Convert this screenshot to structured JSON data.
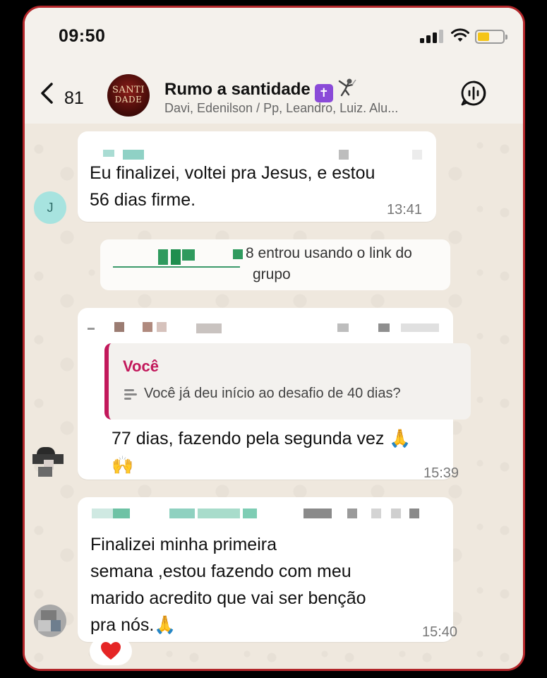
{
  "status_bar": {
    "time": "09:50",
    "battery_color": "#f5c518"
  },
  "header": {
    "back_count": "81",
    "group_name": "Rumo a santidade",
    "group_avatar_line1": "SANTI",
    "group_avatar_line2": "DADE",
    "members": "Davi, Edenilson / Pp, Leandro, Luiz. Alu...",
    "icons": [
      "chevron-left-icon",
      "cross-emoji-icon",
      "fencer-emoji-icon",
      "voice-chat-icon"
    ]
  },
  "messages": [
    {
      "type": "incoming",
      "avatar_initial": "J",
      "text_lines": [
        "Eu finalizei, voltei pra Jesus, e estou",
        "56 dias firme."
      ],
      "time": "13:41"
    },
    {
      "type": "system",
      "text_partial": "8 entrou usando o link do",
      "text_line2": "grupo"
    },
    {
      "type": "incoming",
      "quote": {
        "author": "Você",
        "text": "Você já deu início ao desafio de 40 dias?"
      },
      "text_line1": "77 dias, fazendo pela segunda vez 🙏",
      "text_line2": "🙌",
      "time": "15:39"
    },
    {
      "type": "incoming",
      "text_lines": [
        "Finalizei minha primeira",
        "semana ,estou fazendo com meu",
        "marido acredito que vai ser benção",
        "pra nós.🙏"
      ],
      "time": "15:40",
      "reaction": "❤️"
    }
  ],
  "colors": {
    "quote_accent": "#c2185b",
    "frame": "#b3262a",
    "avatar_j_bg": "#a7e3df"
  }
}
